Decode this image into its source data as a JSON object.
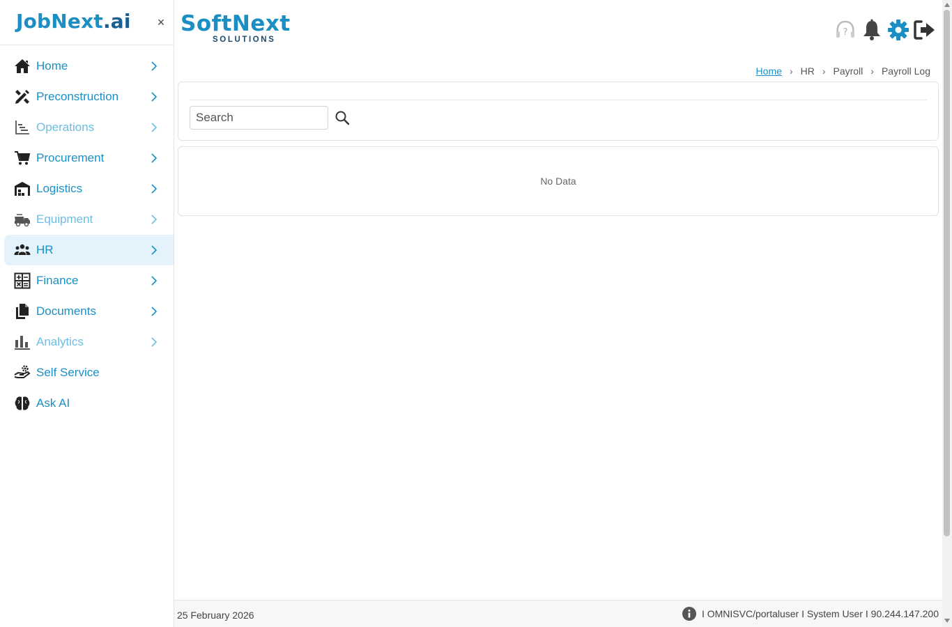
{
  "sidebar": {
    "brand_main": "JobNext",
    "brand_suffix": ".ai",
    "close_symbol": "×",
    "items": [
      {
        "label": "Home",
        "icon": "home-icon"
      },
      {
        "label": "Preconstruction",
        "icon": "design-tools-icon"
      },
      {
        "label": "Operations",
        "icon": "gantt-chart-icon"
      },
      {
        "label": "Procurement",
        "icon": "shopping-cart-icon"
      },
      {
        "label": "Logistics",
        "icon": "warehouse-icon"
      },
      {
        "label": "Equipment",
        "icon": "dump-truck-icon"
      },
      {
        "label": "HR",
        "icon": "people-icon",
        "active": true
      },
      {
        "label": "Finance",
        "icon": "calculator-icon"
      },
      {
        "label": "Documents",
        "icon": "documents-icon"
      },
      {
        "label": "Analytics",
        "icon": "bar-chart-icon"
      },
      {
        "label": "Self Service",
        "icon": "hand-gear-icon"
      },
      {
        "label": "Ask AI",
        "icon": "brain-icon"
      }
    ]
  },
  "header": {
    "logo_main": "SoftNext",
    "logo_sub": "SOLUTIONS",
    "icons": [
      "help-icon",
      "bell-icon",
      "gear-icon",
      "logout-icon"
    ]
  },
  "breadcrumb": {
    "home": "Home",
    "sep": "›",
    "level1": "HR",
    "level2": "Payroll",
    "current": "Payroll Log"
  },
  "search": {
    "placeholder": "Search",
    "value": ""
  },
  "data_panel": {
    "empty_text": "No Data"
  },
  "footer": {
    "date": "25 February 2026",
    "info": "I OMNISVC/portaluser I System User I 90.244.147.200"
  },
  "colors": {
    "accent": "#1b8fc4",
    "accent_muted": "#6cbde3",
    "active_bg": "#e3f2fb",
    "icon_dark": "#333333"
  }
}
